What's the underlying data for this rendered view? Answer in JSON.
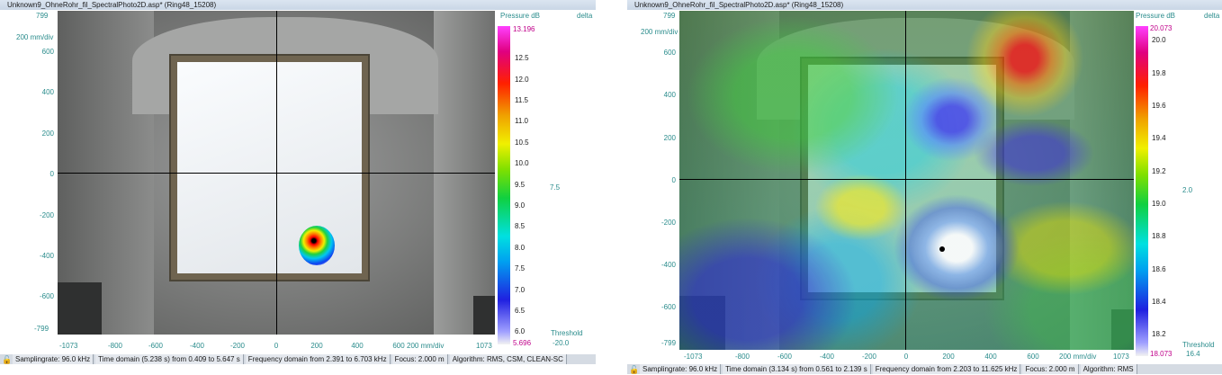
{
  "left": {
    "title": "Unknown9_OhneRohr_fil_SpectralPhoto2D.asp* (Ring48_15208)",
    "y_max_label": "799",
    "y_min_label": "-799",
    "scale_label": "200 mm/div",
    "y_ticks": [
      "600",
      "400",
      "200",
      "0",
      "-200",
      "-400",
      "-600"
    ],
    "x_min_label": "-1073",
    "x_max_label": "1073",
    "x_ticks": [
      "-800",
      "-600",
      "-400",
      "-200",
      "0",
      "200",
      "400",
      "600"
    ],
    "x_scale_label": "200 mm/div",
    "colorbar_title": "Pressure dB",
    "delta_label": "delta",
    "delta_value": "7.5",
    "threshold_label": "Threshold",
    "threshold_value": "-20.0",
    "colorbar_max": "13.196",
    "colorbar_min": "5.696",
    "colorbar_ticks": [
      "12.5",
      "12.0",
      "11.5",
      "11.0",
      "10.5",
      "10.0",
      "9.5",
      "9.0",
      "8.5",
      "8.0",
      "7.5",
      "7.0",
      "6.5",
      "6.0"
    ],
    "status": {
      "samplingrate": "Samplingrate: 96.0 kHz",
      "time_domain": "Time domain (5.238 s) from 0.409 to 5.647 s",
      "frequency_domain": "Frequency domain from 2.391 to 6.703 kHz",
      "focus": "Focus: 2.000 m",
      "algorithm": "Algorithm: RMS, CSM, CLEAN-SC"
    }
  },
  "right": {
    "title": "Unknown9_OhneRohr_fil_SpectralPhoto2D.asp* (Ring48_15208)",
    "y_max_label": "799",
    "y_min_label": "-799",
    "scale_label": "200 mm/div",
    "y_ticks": [
      "600",
      "400",
      "200",
      "0",
      "-200",
      "-400",
      "-600"
    ],
    "x_min_label": "-1073",
    "x_max_label": "1073",
    "x_ticks": [
      "-800",
      "-600",
      "-400",
      "-200",
      "0",
      "200",
      "400",
      "600"
    ],
    "x_scale_label": "200 mm/div",
    "colorbar_title": "Pressure dB",
    "delta_label": "delta",
    "delta_value": "2.0",
    "threshold_label": "Threshold",
    "threshold_value": "16.4",
    "colorbar_max": "20.073",
    "colorbar_min": "18.073",
    "colorbar_ticks": [
      "20.0",
      "19.8",
      "19.6",
      "19.4",
      "19.2",
      "19.0",
      "18.8",
      "18.6",
      "18.4",
      "18.2"
    ],
    "status": {
      "samplingrate": "Samplingrate: 96.0 kHz",
      "time_domain": "Time domain (3.134 s) from 0.561 to 2.139 s",
      "frequency_domain": "Frequency domain from 2.203 to 11.625 kHz",
      "focus": "Focus: 2.000 m",
      "algorithm": "Algorithm: RMS"
    }
  },
  "colors": {
    "axis_label": "#2a8c8c",
    "titlebar": "#c9d6e6",
    "statusbar": "#d5dbe3"
  },
  "icons": {
    "status_lock": "lock-icon"
  }
}
